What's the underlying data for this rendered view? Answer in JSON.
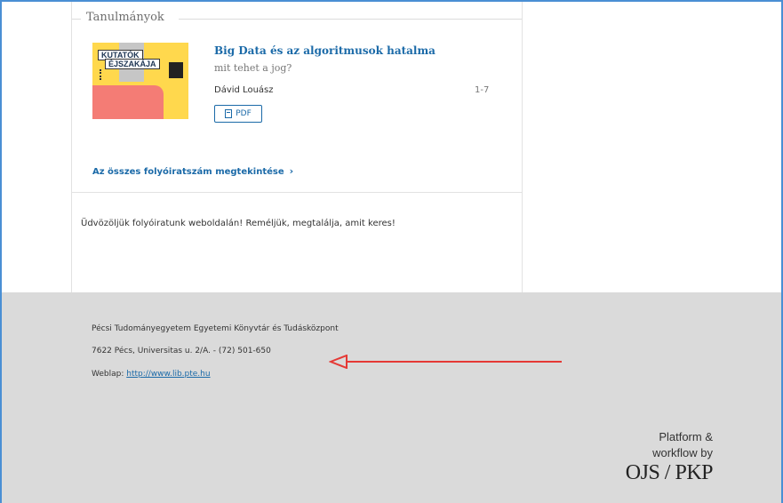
{
  "section": {
    "title": "Tanulmányok"
  },
  "cover": {
    "line1": "KUTATÓK",
    "line2": "ÉJSZAKÁJA"
  },
  "article": {
    "title": "Big Data és az algoritmusok hatalma",
    "subtitle": "mit tehet a jog?",
    "author": "Dávid Louász",
    "pages": "1-7",
    "pdf_label": "PDF"
  },
  "archive_link": {
    "label": "Az összes folyóiratszám megtekintése",
    "chevron": "›"
  },
  "welcome_text": "Üdvözöljük folyóiratunk weboldalán! Reméljük, megtalálja, amit keres!",
  "footer": {
    "institution": "Pécsi Tudományegyetem Egyetemi Könyvtár és Tudásközpont",
    "address": "7622 Pécs, Universitas u. 2/A. - (72) 501-650",
    "weblap_label": "Weblap: ",
    "weblap_url": "http://www.lib.pte.hu"
  },
  "ojs_badge": {
    "line1": "Platform &",
    "line2": "workflow by",
    "brand": "OJS / PKP"
  },
  "colors": {
    "link": "#1b6aa8",
    "footer_bg": "#dadada",
    "annotation_arrow": "#e53935",
    "frame": "#4a8fd4"
  }
}
